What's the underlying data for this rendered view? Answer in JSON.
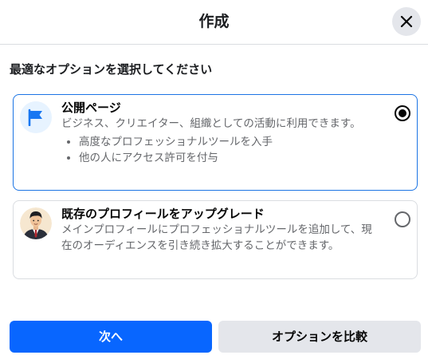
{
  "header": {
    "title": "作成",
    "close_icon": "close-icon"
  },
  "prompt": "最適なオプションを選択してください",
  "options": [
    {
      "icon": "flag-icon",
      "title": "公開ページ",
      "description": "ビジネス、クリエイター、組織としての活動に利用できます。",
      "bullets": [
        "高度なプロフェッショナルツールを入手",
        "他の人にアクセス許可を付与"
      ],
      "selected": true
    },
    {
      "icon": "profile-avatar",
      "title": "既存のプロフィールをアップグレード",
      "description": "メインプロフィールにプロフェッショナルツールを追加して、現在のオーディエンスを引き続き拡大することができます。",
      "selected": false
    }
  ],
  "footer": {
    "next_label": "次へ",
    "compare_label": "オプションを比較"
  },
  "colors": {
    "accent": "#0866ff",
    "selected_border": "#1b74e4",
    "flag": "#1877f2"
  }
}
